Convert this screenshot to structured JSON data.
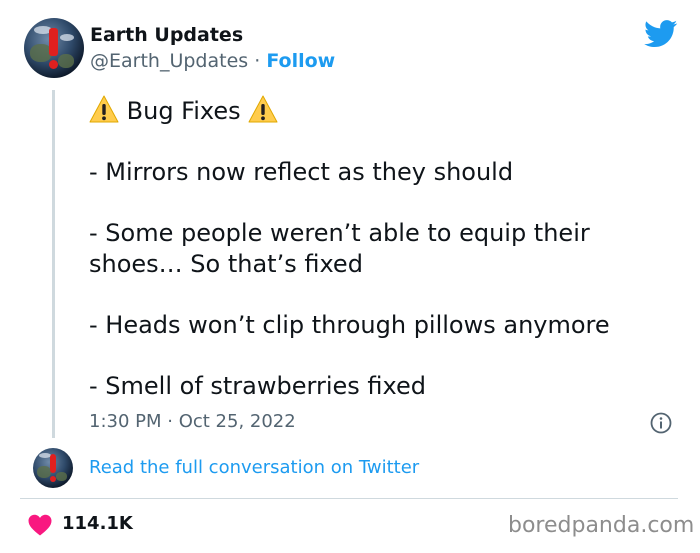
{
  "author": {
    "name": "Earth Updates",
    "handle": "@Earth_Updates",
    "separator": "·",
    "follow_label": "Follow",
    "avatar_icon": "earth-alert-avatar"
  },
  "platform_icon": "twitter-bird-icon",
  "tweet": {
    "heading": "Bug Fixes",
    "heading_icon": "warning-icon",
    "lines": [
      "- Mirrors now reflect as they should",
      "- Some people weren’t able to equip their",
      "shoes… So that’s fixed",
      "- Heads won’t clip through pillows anymore",
      "- Smell of strawberries fixed"
    ],
    "timestamp": "1:30 PM · Oct 25, 2022"
  },
  "info_icon": "info-icon",
  "read_conversation_label": "Read the full conversation on Twitter",
  "likes": {
    "count": "114.1K",
    "icon": "heart-icon"
  },
  "watermark": "boredpanda.com",
  "colors": {
    "accent": "#1d9bf0",
    "heart": "#f91880",
    "text": "#0f1419",
    "muted": "#536471"
  }
}
